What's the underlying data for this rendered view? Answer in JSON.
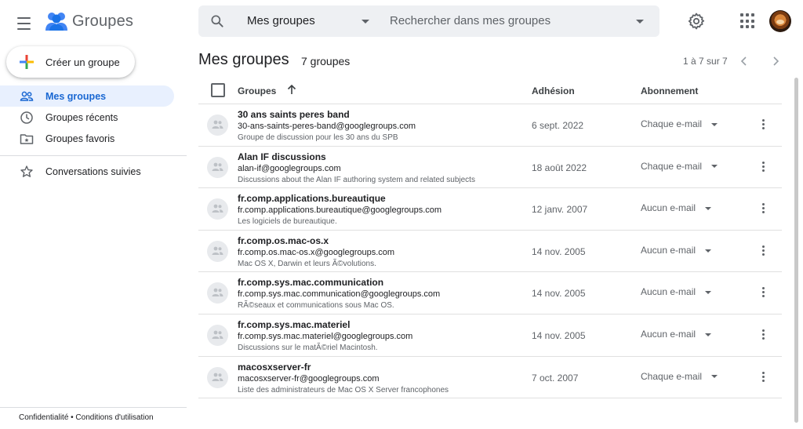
{
  "app": {
    "title": "Groupes"
  },
  "search": {
    "scope": "Mes groupes",
    "placeholder": "Rechercher dans mes groupes"
  },
  "sidebar": {
    "create_label": "Créer un groupe",
    "items": [
      {
        "label": "Mes groupes",
        "icon": "people-outline-icon",
        "active": true
      },
      {
        "label": "Groupes récents",
        "icon": "clock-icon"
      },
      {
        "label": "Groupes favoris",
        "icon": "folder-star-icon"
      },
      {
        "label": "Conversations suivies",
        "icon": "star-outline-icon"
      }
    ],
    "footer": "Confidentialité • Conditions d'utilisation"
  },
  "main": {
    "title": "Mes groupes",
    "count": "7 groupes",
    "pager": "1 à 7 sur 7"
  },
  "table": {
    "headers": {
      "groups": "Groupes",
      "join": "Adhésion",
      "sub": "Abonnement"
    },
    "rows": [
      {
        "name": "30 ans saints peres band",
        "email": "30-ans-saints-peres-band@googlegroups.com",
        "desc": "Groupe de discussion pour les 30 ans du SPB",
        "date": "6 sept. 2022",
        "sub": "Chaque e-mail"
      },
      {
        "name": "Alan IF discussions",
        "email": "alan-if@googlegroups.com",
        "desc": "Discussions about the Alan IF authoring system and related subjects",
        "date": "18 août 2022",
        "sub": "Chaque e-mail"
      },
      {
        "name": "fr.comp.applications.bureautique",
        "email": "fr.comp.applications.bureautique@googlegroups.com",
        "desc": "Les logiciels de bureautique.",
        "date": "12 janv. 2007",
        "sub": "Aucun e-mail"
      },
      {
        "name": "fr.comp.os.mac-os.x",
        "email": "fr.comp.os.mac-os.x@googlegroups.com",
        "desc": "Mac OS X, Darwin et leurs Ã©volutions.",
        "date": "14 nov. 2005",
        "sub": "Aucun e-mail"
      },
      {
        "name": "fr.comp.sys.mac.communication",
        "email": "fr.comp.sys.mac.communication@googlegroups.com",
        "desc": "RÃ©seaux et communications sous Mac OS.",
        "date": "14 nov. 2005",
        "sub": "Aucun e-mail"
      },
      {
        "name": "fr.comp.sys.mac.materiel",
        "email": "fr.comp.sys.mac.materiel@googlegroups.com",
        "desc": "Discussions sur le matÃ©riel Macintosh.",
        "date": "14 nov. 2005",
        "sub": "Aucun e-mail"
      },
      {
        "name": "macosxserver-fr",
        "email": "macosxserver-fr@googlegroups.com",
        "desc": "Liste des administrateurs de Mac OS X Server francophones",
        "date": "7 oct. 2007",
        "sub": "Chaque e-mail"
      }
    ]
  },
  "colors": {
    "accent": "#1967d2",
    "active_bg": "#e8f0fe",
    "logo_blue": "#4285f4"
  }
}
